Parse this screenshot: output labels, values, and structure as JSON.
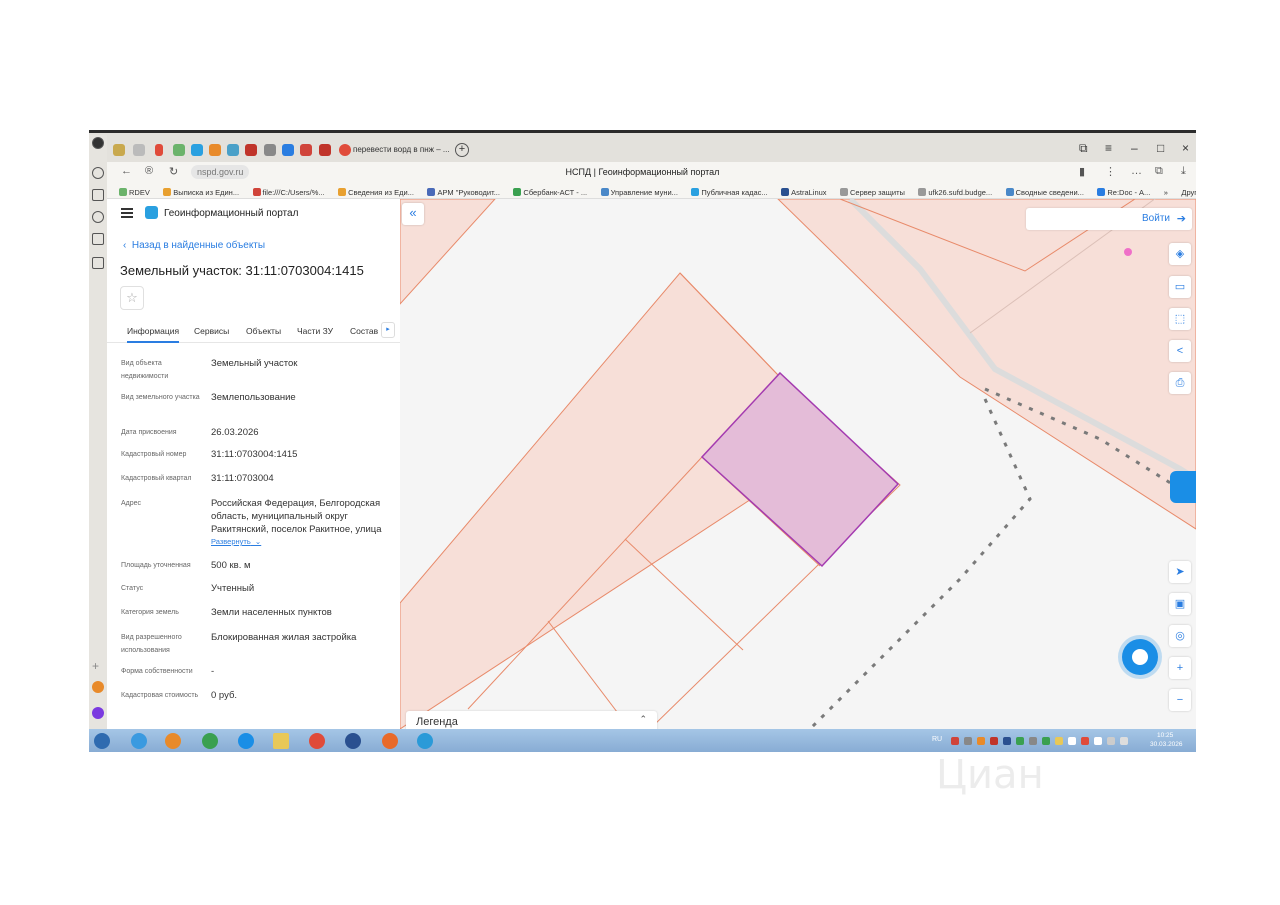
{
  "browser": {
    "active_tab_title": "перевести ворд в пнж – ...",
    "page_title": "НСПД | Геоинформационный портал",
    "url": "nspd.gov.ru",
    "bookmarks": [
      "RDEV",
      "Выписка из Един...",
      "file:///C:/Users/%...",
      "Сведения из Еди...",
      "АРМ \"Руководит...",
      "Сбербанк-АСТ - ...",
      "Управление муни...",
      "Публичная кадас...",
      "AstraLinux",
      "Сервер защиты",
      "ufk26.sufd.budge...",
      "Сводные сведени...",
      "Re:Doc - А...",
      "»",
      "Другие закладки"
    ]
  },
  "panel": {
    "portal_title": "Геоинформационный портал",
    "back_link": "Назад в найденные объекты",
    "parcel_title": "Земельный участок: 31:11:0703004:1415",
    "tabs": [
      "Информация",
      "Сервисы",
      "Объекты",
      "Части ЗУ",
      "Состав"
    ],
    "rows": [
      {
        "label": "Вид объекта недвижимости",
        "value": "Земельный участок"
      },
      {
        "label": "Вид земельного участка",
        "value": "Землепользование"
      },
      {
        "label": "Дата присвоения",
        "value": "26.03.2026"
      },
      {
        "label": "Кадастровый номер",
        "value": "31:11:0703004:1415"
      },
      {
        "label": "Кадастровый квартал",
        "value": "31:11:0703004"
      },
      {
        "label": "Адрес",
        "value": "Российская Федерация, Белгородская область, муниципальный округ Ракитянский, поселок Ракитное, улица"
      },
      {
        "label": "Площадь уточненная",
        "value": "500 кв. м"
      },
      {
        "label": "Статус",
        "value": "Учтенный"
      },
      {
        "label": "Категория земель",
        "value": "Земли населенных пунктов"
      },
      {
        "label": "Вид разрешенного использования",
        "value": "Блокированная жилая застройка"
      },
      {
        "label": "Форма собственности",
        "value": "-"
      },
      {
        "label": "Кадастровая стоимость",
        "value": "0 руб."
      }
    ],
    "expand_link": "Развернуть"
  },
  "map": {
    "collapse_glyph": "«",
    "login_label": "Войти",
    "legend_label": "Легенда",
    "parcel_fill_color": "#e4bcd8",
    "parcel_stroke_color": "#a43bb0",
    "zone_stroke_color": "#e88a6a"
  },
  "taskbar": {
    "lang": "RU",
    "time": "10:25",
    "date": "30.03.2026"
  },
  "watermark": "Циан"
}
